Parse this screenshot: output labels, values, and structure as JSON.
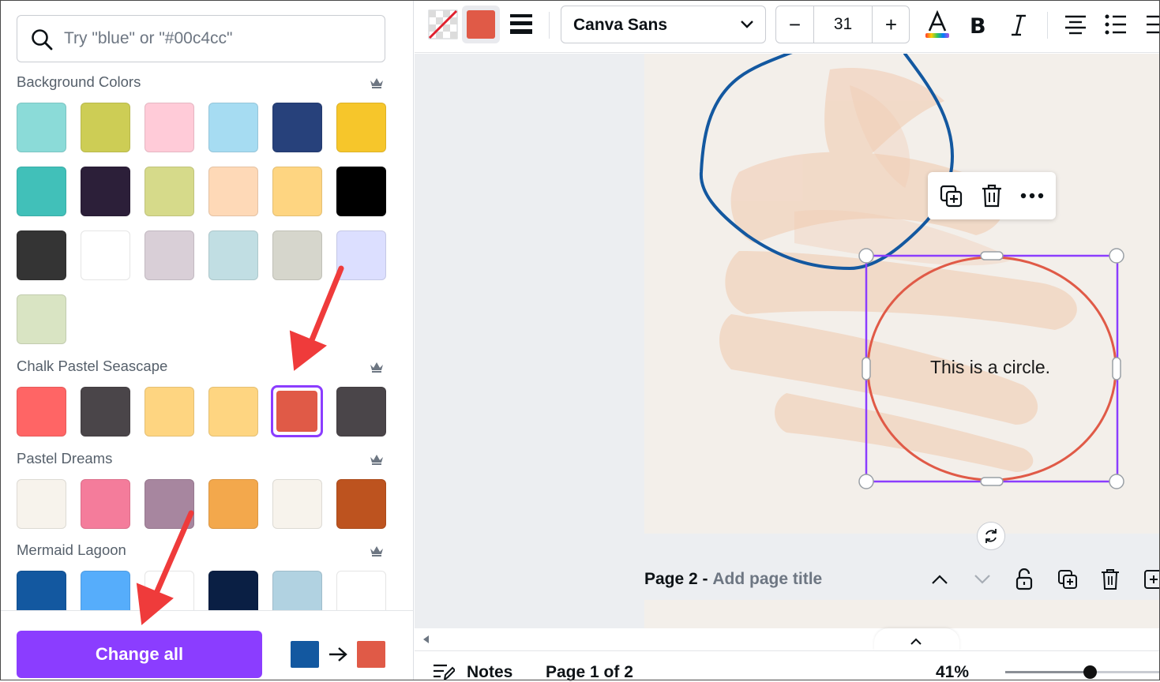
{
  "search": {
    "placeholder": "Try \"blue\" or \"#00c4cc\""
  },
  "palettes": [
    {
      "title": "Background Colors",
      "colors": [
        "#8bdbd8",
        "#cdcd55",
        "#ffcbd8",
        "#a6dcf2",
        "#27417b",
        "#f6c62b",
        "#41c0b9",
        "#2c1f39",
        "#d6da8a",
        "#fed9b7",
        "#fed581",
        "#000000",
        "#343434",
        "#ffffff",
        "#d9cfd7",
        "#c1dee3",
        "#d6d6cc",
        "#dcdfff",
        "#d9e4c3"
      ]
    },
    {
      "title": "Chalk Pastel Seascape",
      "colors": [
        "#ff6565",
        "#4a4549",
        "#fed581",
        "#fed581",
        "#e05a47",
        "#4a4549"
      ],
      "selected_index": 4
    },
    {
      "title": "Pastel Dreams",
      "colors": [
        "#f7f3ec",
        "#f47c9b",
        "#a7869f",
        "#f3a84c",
        "#f7f3ec",
        "#bd531f"
      ]
    },
    {
      "title": "Mermaid Lagoon",
      "colors": [
        "#1358a0",
        "#56adfb",
        "#ffffff",
        "#0a1f44",
        "#b1d2e1",
        "#ffffff"
      ]
    }
  ],
  "footer": {
    "change_all_label": "Change all",
    "from_color": "#1358a0",
    "to_color": "#e05a47"
  },
  "toolbar": {
    "font_name": "Canva Sans",
    "font_size": "31",
    "minus_label": "−",
    "plus_label": "+",
    "fill_color": "#e05a47"
  },
  "canvas": {
    "circle_text": "This is a circle.",
    "page2_prefix": "Page 2 -",
    "page2_title_placeholder": "Add page title"
  },
  "status": {
    "notes_label": "Notes",
    "page_indicator": "Page 1 of 2",
    "zoom_label": "41%",
    "zoom_fraction": 0.41
  }
}
